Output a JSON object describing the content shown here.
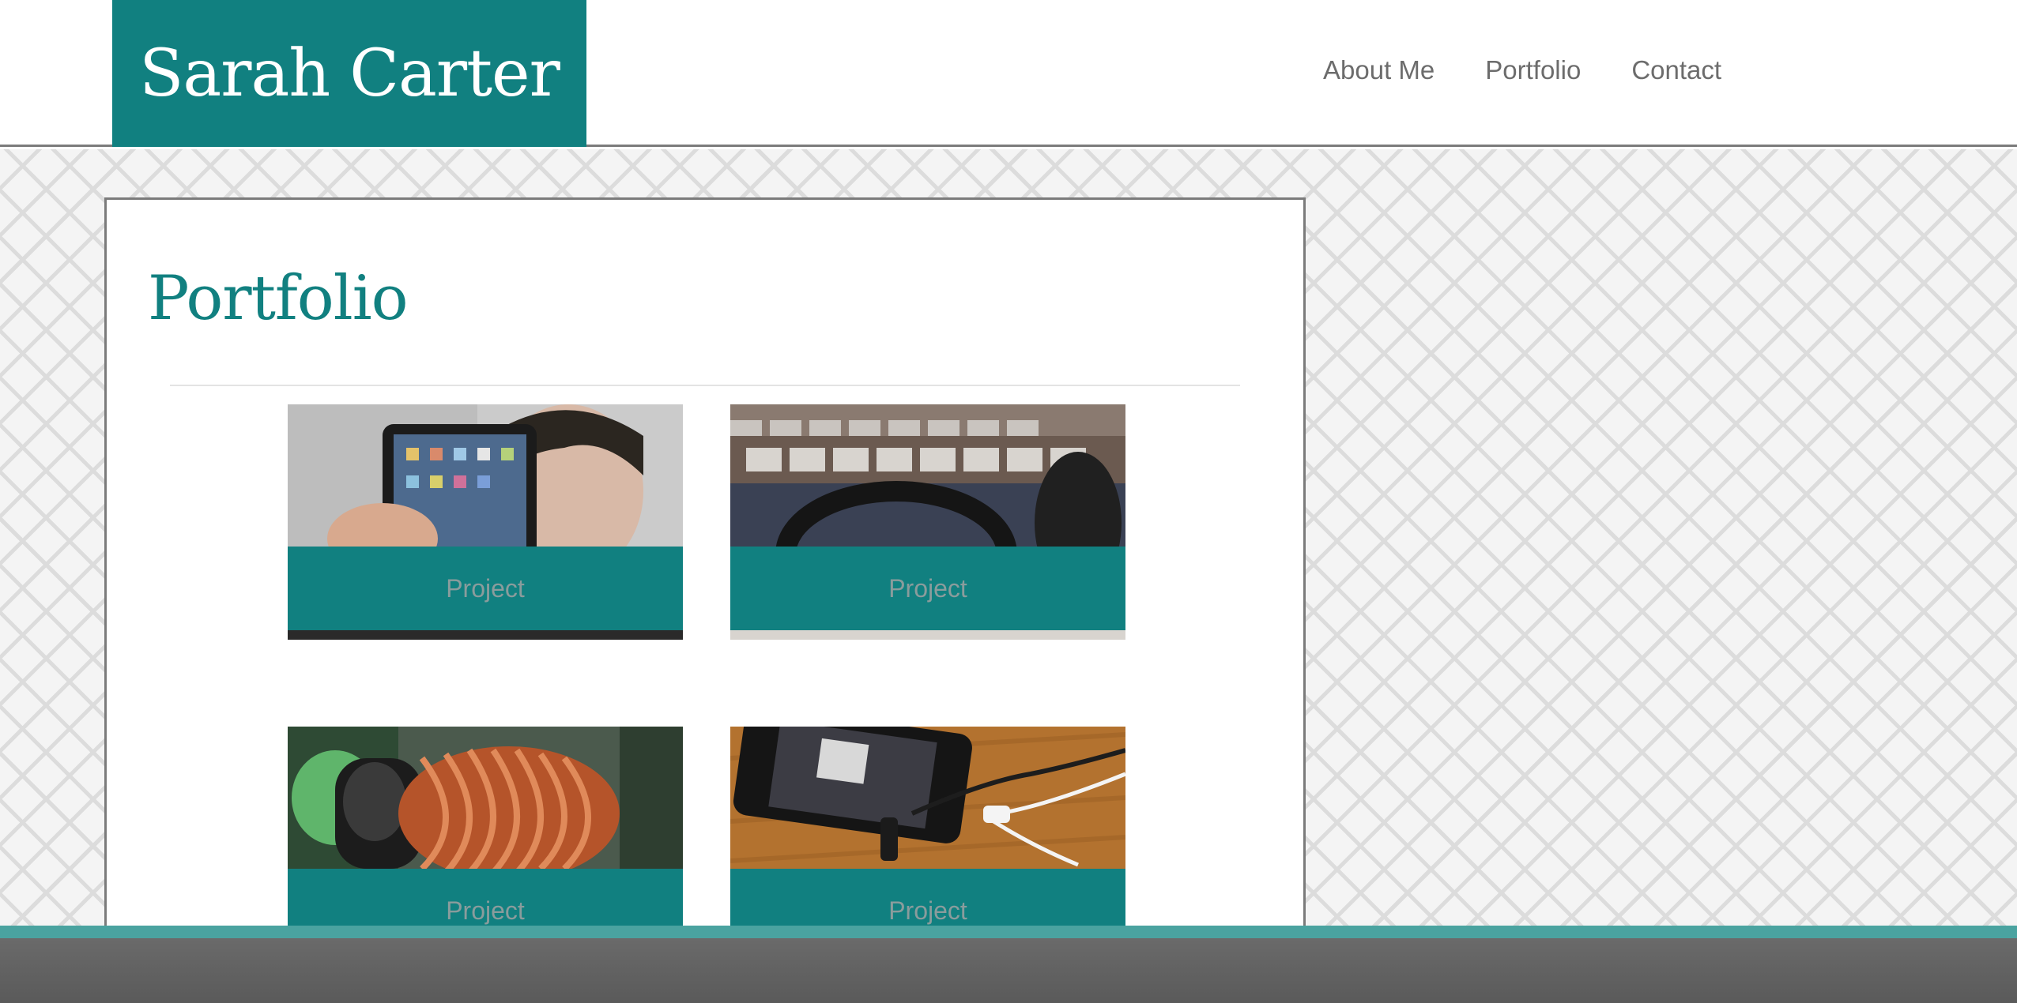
{
  "header": {
    "brand": "Sarah Carter",
    "nav": [
      {
        "label": "About Me"
      },
      {
        "label": "Portfolio"
      },
      {
        "label": "Contact"
      }
    ]
  },
  "main": {
    "title": "Portfolio",
    "projects": [
      {
        "label": "Project",
        "image": "tablet-photo"
      },
      {
        "label": "Project",
        "image": "keyboard-headphones-photo"
      },
      {
        "label": "Project",
        "image": "copper-coil-photo"
      },
      {
        "label": "Project",
        "image": "smartphone-earphones-photo"
      }
    ]
  },
  "colors": {
    "brand": "#118080",
    "nav_text": "#6c6c6c",
    "footer_accent": "#4aa3a0",
    "footer": "#5f5f5f"
  }
}
